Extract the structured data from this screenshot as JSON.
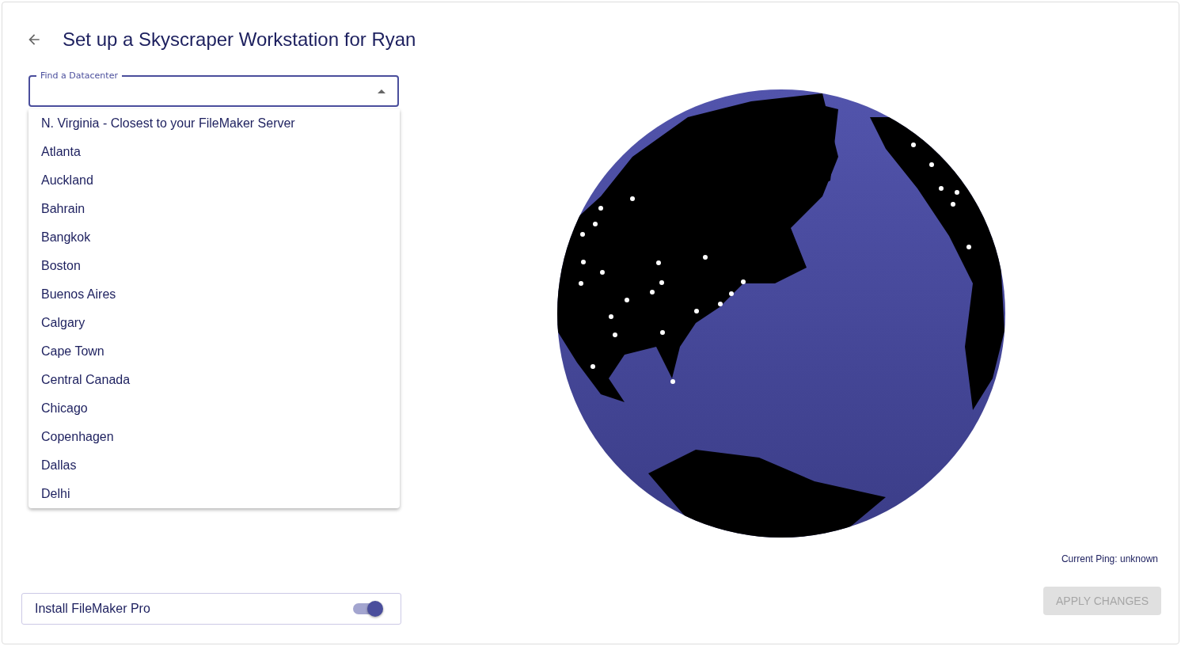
{
  "header": {
    "title": "Set up a Skyscraper Workstation for Ryan"
  },
  "datacenter_field": {
    "label": "Find a Datacenter",
    "expanded": true
  },
  "datacenter_options": [
    "N. Virginia - Closest to your FileMaker Server",
    "Atlanta",
    "Auckland",
    "Bahrain",
    "Bangkok",
    "Boston",
    "Buenos Aires",
    "Calgary",
    "Cape Town",
    "Central Canada",
    "Chicago",
    "Copenhagen",
    "Dallas",
    "Delhi"
  ],
  "install_option": {
    "label": "Install FileMaker Pro",
    "on": true
  },
  "ping": {
    "text": "Current Ping: unknown"
  },
  "apply_button": {
    "label": "APPLY CHANGES",
    "disabled": true
  }
}
